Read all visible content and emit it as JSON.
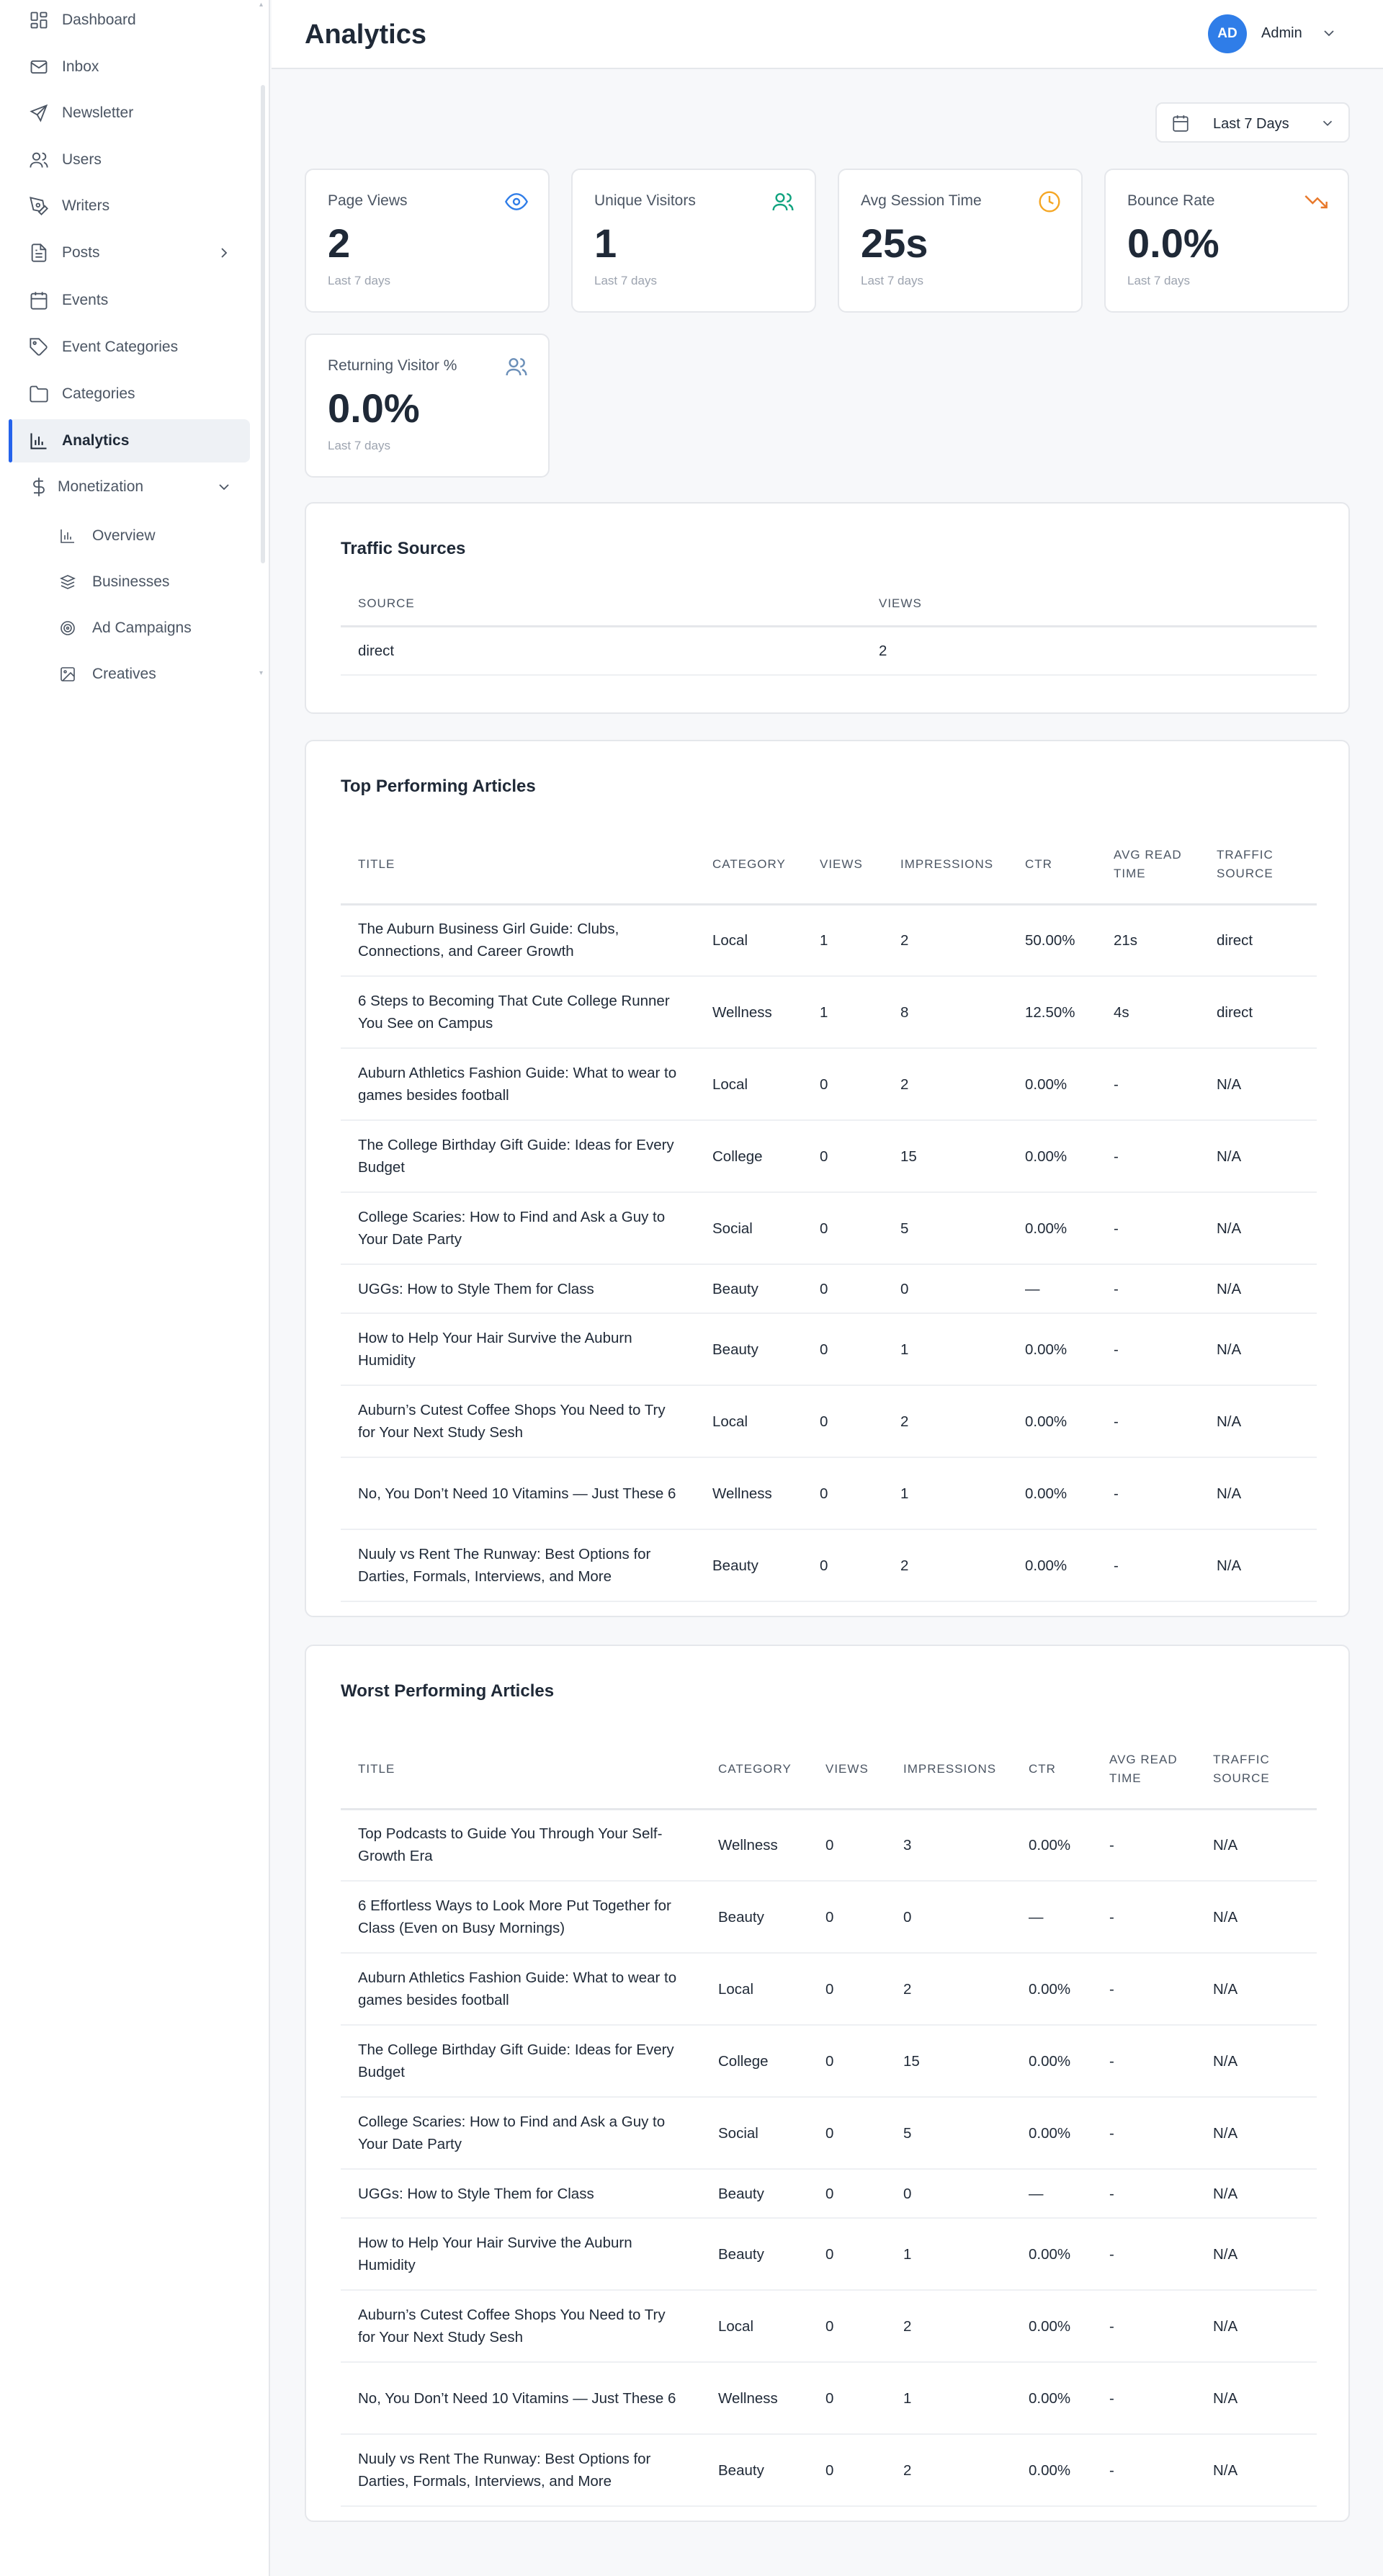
{
  "app": {
    "page_title": "Analytics",
    "user": {
      "initials": "AD",
      "name": "Admin"
    }
  },
  "colors": {
    "accent": "#2563eb",
    "avatar": "#2f7de8",
    "views_icon": "#2f7de8",
    "visitors_icon": "#10a37f",
    "session_icon": "#f5a623",
    "bounce_icon": "#e8782a",
    "returning_icon": "#6b8fb8"
  },
  "sidebar": {
    "items": [
      {
        "label": "Dashboard",
        "icon": "grid-icon"
      },
      {
        "label": "Inbox",
        "icon": "mail-icon"
      },
      {
        "label": "Newsletter",
        "icon": "send-icon"
      },
      {
        "label": "Users",
        "icon": "users-icon"
      },
      {
        "label": "Writers",
        "icon": "pen-icon"
      },
      {
        "label": "Posts",
        "icon": "file-icon"
      },
      {
        "label": "Events",
        "icon": "calendar-icon"
      },
      {
        "label": "Event Categories",
        "icon": "tag-icon"
      },
      {
        "label": "Categories",
        "icon": "folder-icon"
      },
      {
        "label": "Analytics",
        "icon": "bar-chart-icon"
      },
      {
        "label": "Monetization",
        "icon": "dollar-icon"
      }
    ],
    "sub_items": [
      {
        "label": "Overview",
        "icon": "bar-chart-icon"
      },
      {
        "label": "Businesses",
        "icon": "badge-icon"
      },
      {
        "label": "Ad Campaigns",
        "icon": "target-icon"
      },
      {
        "label": "Creatives",
        "icon": "image-icon"
      }
    ]
  },
  "date_filter": {
    "label": "Last 7 Days"
  },
  "stats": [
    {
      "label": "Page Views",
      "value": "2",
      "sub": "Last 7 days",
      "icon": "eye-icon"
    },
    {
      "label": "Unique Visitors",
      "value": "1",
      "sub": "Last 7 days",
      "icon": "users-icon"
    },
    {
      "label": "Avg Session Time",
      "value": "25s",
      "sub": "Last 7 days",
      "icon": "clock-icon"
    },
    {
      "label": "Bounce Rate",
      "value": "0.0%",
      "sub": "Last 7 days",
      "icon": "trending-down-icon"
    },
    {
      "label": "Returning Visitor %",
      "value": "0.0%",
      "sub": "Last 7 days",
      "icon": "users-icon"
    }
  ],
  "traffic_sources": {
    "title": "Traffic Sources",
    "headers": [
      "Source",
      "Views"
    ],
    "rows": [
      [
        "direct",
        "2"
      ]
    ]
  },
  "top_articles": {
    "title": "Top Performing Articles",
    "headers": [
      "Title",
      "Category",
      "Views",
      "Impressions",
      "CTR",
      "Avg Read Time",
      "Traffic Source"
    ],
    "rows": [
      [
        "The Auburn Business Girl Guide: Clubs, Connections, and Career Growth",
        "Local",
        "1",
        "2",
        "50.00%",
        "21s",
        "direct"
      ],
      [
        "6 Steps to Becoming That Cute College Runner You See on Campus",
        "Wellness",
        "1",
        "8",
        "12.50%",
        "4s",
        "direct"
      ],
      [
        "Auburn Athletics Fashion Guide: What to wear to games besides football",
        "Local",
        "0",
        "2",
        "0.00%",
        "-",
        "N/A"
      ],
      [
        "The College Birthday Gift Guide: Ideas for Every Budget",
        "College",
        "0",
        "15",
        "0.00%",
        "-",
        "N/A"
      ],
      [
        "College Scaries: How to Find and Ask a Guy to Your Date Party",
        "Social",
        "0",
        "5",
        "0.00%",
        "-",
        "N/A"
      ],
      [
        "UGGs: How to Style Them for Class",
        "Beauty",
        "0",
        "0",
        "—",
        "-",
        "N/A"
      ],
      [
        "How to Help Your Hair Survive the Auburn Humidity",
        "Beauty",
        "0",
        "1",
        "0.00%",
        "-",
        "N/A"
      ],
      [
        "Auburn’s Cutest Coffee Shops You Need to Try for Your Next Study Sesh",
        "Local",
        "0",
        "2",
        "0.00%",
        "-",
        "N/A"
      ],
      [
        "No, You Don’t Need 10 Vitamins — Just These 6",
        "Wellness",
        "0",
        "1",
        "0.00%",
        "-",
        "N/A"
      ],
      [
        "Nuuly vs Rent The Runway: Best Options for Darties, Formals, Interviews, and More",
        "Beauty",
        "0",
        "2",
        "0.00%",
        "-",
        "N/A"
      ]
    ]
  },
  "worst_articles": {
    "title": "Worst Performing Articles",
    "headers": [
      "Title",
      "Category",
      "Views",
      "Impressions",
      "CTR",
      "Avg Read Time",
      "Traffic Source"
    ],
    "rows": [
      [
        "Top Podcasts to Guide You Through Your Self-Growth Era",
        "Wellness",
        "0",
        "3",
        "0.00%",
        "-",
        "N/A"
      ],
      [
        "6 Effortless Ways to Look More Put Together for Class (Even on Busy Mornings)",
        "Beauty",
        "0",
        "0",
        "—",
        "-",
        "N/A"
      ],
      [
        "Auburn Athletics Fashion Guide: What to wear to games besides football",
        "Local",
        "0",
        "2",
        "0.00%",
        "-",
        "N/A"
      ],
      [
        "The College Birthday Gift Guide: Ideas for Every Budget",
        "College",
        "0",
        "15",
        "0.00%",
        "-",
        "N/A"
      ],
      [
        "College Scaries: How to Find and Ask a Guy to Your Date Party",
        "Social",
        "0",
        "5",
        "0.00%",
        "-",
        "N/A"
      ],
      [
        "UGGs: How to Style Them for Class",
        "Beauty",
        "0",
        "0",
        "—",
        "-",
        "N/A"
      ],
      [
        "How to Help Your Hair Survive the Auburn Humidity",
        "Beauty",
        "0",
        "1",
        "0.00%",
        "-",
        "N/A"
      ],
      [
        "Auburn’s Cutest Coffee Shops You Need to Try for Your Next Study Sesh",
        "Local",
        "0",
        "2",
        "0.00%",
        "-",
        "N/A"
      ],
      [
        "No, You Don’t Need 10 Vitamins — Just These 6",
        "Wellness",
        "0",
        "1",
        "0.00%",
        "-",
        "N/A"
      ],
      [
        "Nuuly vs Rent The Runway: Best Options for Darties, Formals, Interviews, and More",
        "Beauty",
        "0",
        "2",
        "0.00%",
        "-",
        "N/A"
      ]
    ]
  }
}
